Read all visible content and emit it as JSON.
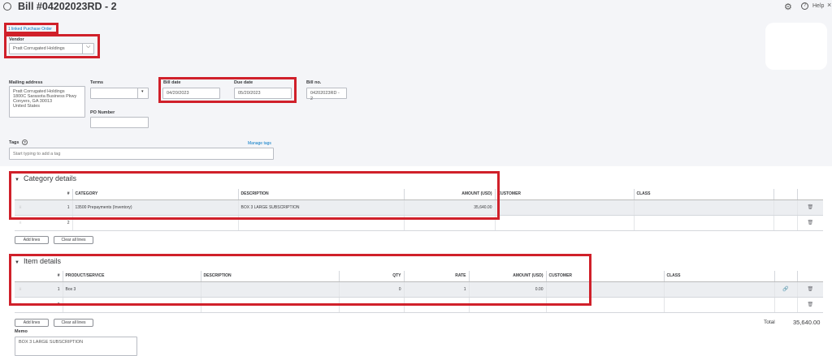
{
  "header": {
    "title": "Bill #04202023RD - 2",
    "help_label": "Help"
  },
  "linked_po": "1 linked Purchase Order",
  "vendor": {
    "label": "Vendor",
    "value": "Pratt Corrugated Holdings"
  },
  "mailing": {
    "label": "Mailing address",
    "lines": [
      "Pratt Corrugated Holdings",
      "1800C Sarasota Business Pkwy",
      "Conyers, GA  30013",
      "United States"
    ]
  },
  "terms": {
    "label": "Terms",
    "value": ""
  },
  "bill_date": {
    "label": "Bill date",
    "value": "04/20/2023"
  },
  "due_date": {
    "label": "Due date",
    "value": "05/20/2023"
  },
  "bill_no": {
    "label": "Bill no.",
    "value": "04202023RD - 2"
  },
  "po_number": {
    "label": "PO Number",
    "value": ""
  },
  "tags": {
    "label": "Tags",
    "placeholder": "Start typing to add a tag",
    "manage_label": "Manage tags"
  },
  "category_details": {
    "title": "Category details",
    "headers": [
      "#",
      "CATEGORY",
      "DESCRIPTION",
      "AMOUNT (USD)",
      "CUSTOMER",
      "CLASS"
    ],
    "rows": [
      {
        "num": "1",
        "category": "13500 Prepayments (Inventory)",
        "description": "BOX 3 LARGE SUBSCRIPTION",
        "amount": "35,640.00",
        "customer": "",
        "class": ""
      },
      {
        "num": "2",
        "category": "",
        "description": "",
        "amount": "",
        "customer": "",
        "class": ""
      }
    ],
    "add_lines": "Add lines",
    "clear_lines": "Clear all lines"
  },
  "item_details": {
    "title": "Item details",
    "headers": [
      "#",
      "PRODUCT/SERVICE",
      "DESCRIPTION",
      "QTY",
      "RATE",
      "AMOUNT (USD)",
      "CUSTOMER",
      "CLASS"
    ],
    "rows": [
      {
        "num": "1",
        "product": "Box 3",
        "description": "",
        "qty": "0",
        "rate": "1",
        "amount": "0.00",
        "customer": "",
        "class": ""
      },
      {
        "num": "2",
        "product": "",
        "description": "",
        "qty": "",
        "rate": "",
        "amount": "",
        "customer": "",
        "class": ""
      }
    ],
    "add_lines": "Add lines",
    "clear_lines": "Clear all lines"
  },
  "total": {
    "label": "Total",
    "value": "35,640.00"
  },
  "memo": {
    "label": "Memo",
    "value": "BOX 3 LARGE SUBSCRIPTION"
  },
  "icons": {
    "history": "history-icon",
    "settings": "gear-icon",
    "help": "help-icon",
    "close": "close-icon",
    "trash": "trash-icon",
    "link": "link-icon",
    "handle": "drag-handle-icon"
  }
}
